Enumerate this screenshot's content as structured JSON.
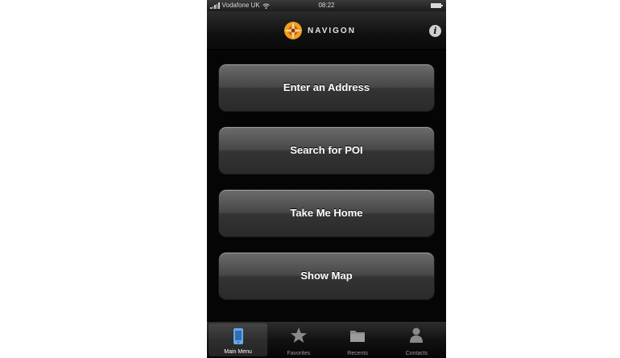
{
  "status_bar": {
    "carrier": "Vodafone UK",
    "time": "08:22"
  },
  "nav_bar": {
    "logo_text": "NAVIGON"
  },
  "menu": {
    "buttons": [
      {
        "label": "Enter an Address"
      },
      {
        "label": "Search for POI"
      },
      {
        "label": "Take Me Home"
      },
      {
        "label": "Show Map"
      }
    ]
  },
  "tab_bar": {
    "tabs": [
      {
        "label": "Main Menu",
        "icon": "main-menu-icon",
        "active": true
      },
      {
        "label": "Favorites",
        "icon": "star-icon",
        "active": false
      },
      {
        "label": "Recents",
        "icon": "folder-icon",
        "active": false
      },
      {
        "label": "Contacts",
        "icon": "person-icon",
        "active": false
      }
    ]
  },
  "colors": {
    "background": "#050505",
    "button_top": "#6c6c6c",
    "button_bottom": "#2a2a2a",
    "logo_orange": "#f0a020"
  }
}
